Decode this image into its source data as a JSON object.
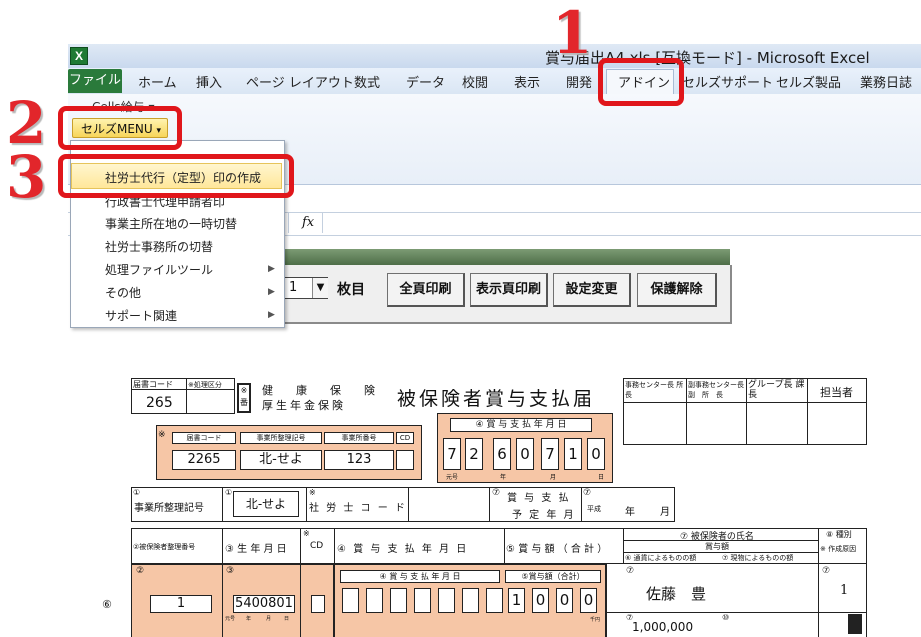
{
  "window": {
    "title": "賞与届出A4.xls [互換モード] - Microsoft Excel",
    "tabs": [
      "ファイル",
      "ホーム",
      "挿入",
      "ページ レイアウト",
      "数式",
      "データ",
      "校閲",
      "表示",
      "開発",
      "アドイン",
      "セルズサポート",
      "セルズ製品",
      "業務日誌"
    ]
  },
  "ribbon": {
    "cells_menu": "Cells給与",
    "selz_menu_button": "セルズMENU"
  },
  "formula_bar": {
    "fx": "fx"
  },
  "menu": {
    "items": [
      {
        "label": "社労士代行（定型）印の作成",
        "submenu": false
      },
      {
        "label": "行政書士代理申請者印",
        "submenu": false
      },
      {
        "label": "事業主所在地の一時切替",
        "submenu": false
      },
      {
        "label": "社労士事務所の切替",
        "submenu": false
      },
      {
        "label": "処理ファイルツール",
        "submenu": true
      },
      {
        "label": "その他",
        "submenu": true
      },
      {
        "label": "サポート関連",
        "submenu": true
      }
    ]
  },
  "callouts": {
    "one": "1",
    "two": "2",
    "three": "3"
  },
  "form_toolbar": {
    "page_value": "1",
    "page_unit": "枚目",
    "buttons": [
      "全頁印刷",
      "表示頁印刷",
      "設定変更",
      "保護解除"
    ]
  },
  "form": {
    "title": "被保険者賞与支払届",
    "label_todoke_code": "届書コード",
    "label_shori_kubun": "※処理区分",
    "todoke_code_value": "265",
    "kome_label": "※番",
    "kenpo_line": "健　康　保　険",
    "kounen_line": "厚生年金保険",
    "approval_headers": [
      "事務センター長 所　　長",
      "副事務センター長 副　所　長",
      "グループ長 課　　長",
      "担当者"
    ],
    "peach1": {
      "kome": "※",
      "h1": "届書コード",
      "h2": "事業所整理記号",
      "h3": "事業所番号",
      "h4": "CD",
      "v1": "2265",
      "v2": "北-せよ",
      "v3": "123",
      "v4": ""
    },
    "pay_date": {
      "label": "④ 賞 与 支 払 年 月 日",
      "digits": [
        "7",
        "2",
        "6",
        "0",
        "7",
        "1",
        "0"
      ],
      "sub": [
        "元号",
        "年",
        "月",
        "日"
      ]
    },
    "row3": {
      "label1_num": "①",
      "label1": "事業所整理記号",
      "box_num": "①",
      "box_value": "北-せよ",
      "sharoushi_label": "社 労 士 コ ー ド",
      "kome": "※",
      "yotei_num": "⑦",
      "yotei_label1": "賞 与 支 払",
      "yotei_label2": "予 定 年 月",
      "yotei_num2": "⑦",
      "yotei_gengo": "平成",
      "yotei_nen": "年",
      "yotei_tsuki": "月"
    },
    "row4_headers": {
      "seiri": "②被保険者整理番号",
      "seinen": "③ 生 年 月 日",
      "cd_kome": "※",
      "cd": "CD",
      "shiharai": "④ 賞 与 支 払 年 月 日",
      "gaku": "⑤ 賞 与 額 （ 合 計 ）",
      "name_header": "⑦ 被保険者の氏名",
      "gaku2": "賞与額",
      "tsuuka": "⑥ 通貨によるものの額",
      "genmotsu": "⑦ 現物によるものの額",
      "shubetsu": "⑧ 種別",
      "sakusei": "※ 作成原因"
    },
    "row5": {
      "marker": "⑥",
      "seiri_num": "②",
      "seiri_value": "1",
      "seinen_num": "③",
      "seinen_value": "5400801",
      "seinen_sub": [
        "元号",
        "年",
        "月",
        "日"
      ],
      "shiharai_label": "④ 賞 与 支 払 年 月 日",
      "gaku_label": "⑤賞与額（合計）",
      "gaku_digits": [
        "",
        "",
        "",
        "",
        "",
        "",
        "1",
        "0",
        "0",
        "0"
      ],
      "gaku_unit": "千円",
      "name_num": "⑦",
      "name_value": "佐藤　豊",
      "shubetsu_num": "⑦",
      "shubetsu_value": "1",
      "bottom_amount": "1,000,000",
      "bottom_num": "⑦",
      "bottom_num2": "⑩"
    }
  }
}
